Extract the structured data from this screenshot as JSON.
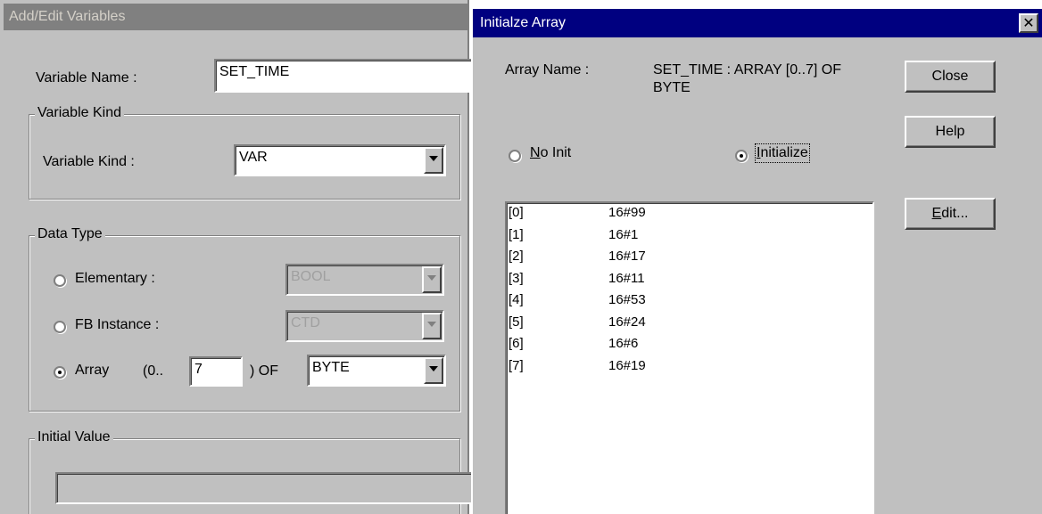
{
  "add_edit": {
    "title": "Add/Edit Variables",
    "variable_name_label": "Variable Name :",
    "variable_name_value": "SET_TIME",
    "variable_kind_group": "Variable Kind",
    "variable_kind_label": "Variable Kind :",
    "variable_kind_value": "VAR",
    "data_type_group": "Data Type",
    "elementary_label": "Elementary :",
    "elementary_value": "BOOL",
    "fb_instance_label": "FB Instance :",
    "fb_instance_value": "CTD",
    "array_label": "Array",
    "array_range_prefix": "(0..",
    "array_upper": "7",
    "array_of_label": ") OF",
    "array_type_value": "BYTE",
    "initial_value_group": "Initial Value",
    "initial_value": ""
  },
  "init_array": {
    "title": "Initialze Array",
    "close_glyph": "✕",
    "array_name_label": "Array Name :",
    "array_name_line1": "SET_TIME : ARRAY [0..7] OF",
    "array_name_line2": "BYTE",
    "no_init_label": "No Init",
    "no_init_mnemonic": "N",
    "no_init_rest": "o Init",
    "initialize_label": "Initialize",
    "initialize_mnemonic": "I",
    "initialize_rest": "nitialize",
    "buttons": {
      "close": "Close",
      "help": "Help",
      "edit_mnemonic": "E",
      "edit_rest": "dit..."
    },
    "rows": [
      {
        "index": "[0]",
        "value": "16#99"
      },
      {
        "index": "[1]",
        "value": "16#1"
      },
      {
        "index": "[2]",
        "value": "16#17"
      },
      {
        "index": "[3]",
        "value": "16#11"
      },
      {
        "index": "[4]",
        "value": "16#53"
      },
      {
        "index": "[5]",
        "value": "16#24"
      },
      {
        "index": "[6]",
        "value": "16#6"
      },
      {
        "index": "[7]",
        "value": "16#19"
      }
    ]
  },
  "colors": {
    "face": "#c0c0c0",
    "active_title": "#000080",
    "inactive_title": "#808080"
  }
}
